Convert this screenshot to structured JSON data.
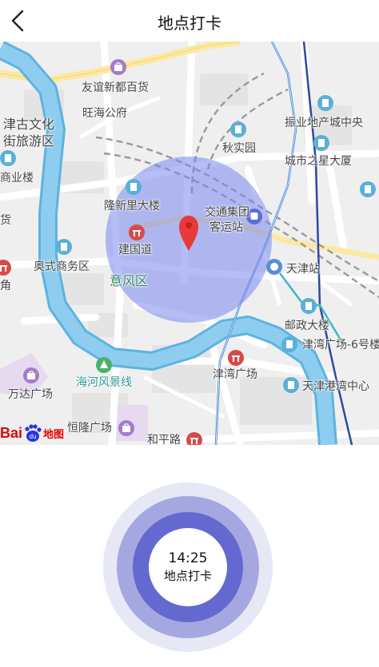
{
  "header": {
    "title": "地点打卡",
    "back_icon": "chevron-left-icon"
  },
  "map": {
    "labels": {
      "youyi": "友谊新都百货",
      "wanghai": "旺海公府",
      "jingu1": "津古文化",
      "jingu2": "街旅游区",
      "shangye": "商业楼",
      "huo": "货",
      "longxin": "隆新里大楼",
      "jianguo": "建国道",
      "aoshi": "奥式商务区",
      "jiao": "角",
      "yifeng": "意风区",
      "jiaotong1": "交通集团",
      "jiaotong2": "客运站",
      "tianjinzhan": "天津站",
      "zhenye": "振业地产城中央",
      "qiushi": "秋实园",
      "chengshi": "城市之星大厦",
      "youzheng": "邮政大楼",
      "jinwan6": "津湾广场-6号楼",
      "jinwan": "津湾广场",
      "tianjingang": "天津港湾中心",
      "haihe": "海河风景线",
      "wanda": "万达广场",
      "henglong": "恒隆广场",
      "heping": "和平路"
    },
    "colors": {
      "water": "#8ecdf0",
      "river_edge": "#5eb3e0",
      "road": "#ffffff",
      "main_road": "#fbe9a3",
      "range_circle": "#7a86ee",
      "metro_blue": "#3d7fd9",
      "metro_navy": "#2c4aa0",
      "metro_teal": "#3fb6c4",
      "marker": "#e83a3a"
    },
    "logo": {
      "brand": "Bai",
      "paw": "du",
      "suffix": "地图"
    }
  },
  "checkin": {
    "time": "14:25",
    "label": "地点打卡",
    "colors": [
      "#e7e8f6",
      "#a5a8e0",
      "#6469cf",
      "#ffffff"
    ]
  }
}
